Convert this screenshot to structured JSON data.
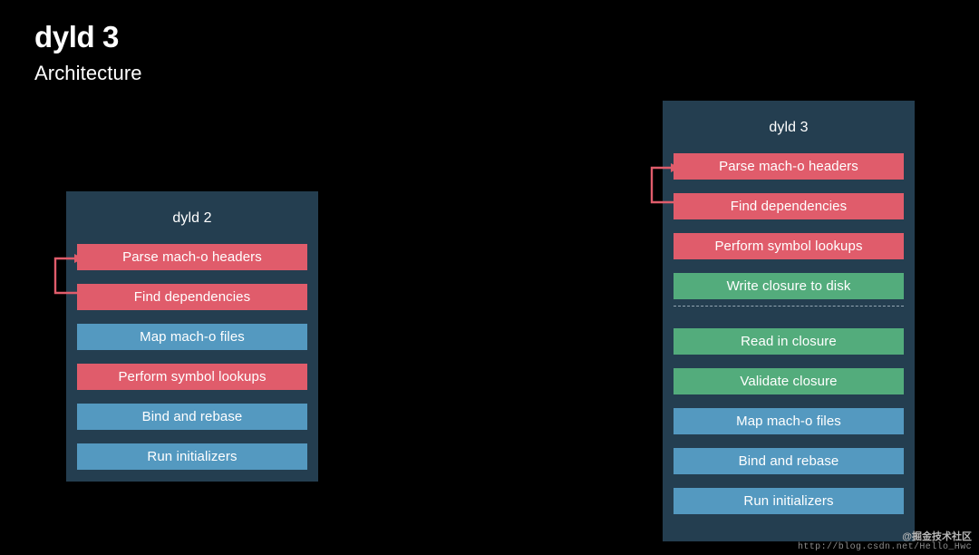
{
  "slide": {
    "title": "dyld 3",
    "subtitle": "Architecture",
    "background_color": "#000000"
  },
  "colors": {
    "panel": "#243e50",
    "red": "#e05c6b",
    "blue": "#5499c0",
    "green": "#53ac7c",
    "arrow": "#e05c6b",
    "divider": "#93a6b2",
    "text": "#ffffff"
  },
  "panels": [
    {
      "id": "dyld2",
      "title": "dyld 2",
      "steps": [
        {
          "label": "Parse mach-o headers",
          "color": "red"
        },
        {
          "label": "Find dependencies",
          "color": "red"
        },
        {
          "label": "Map mach-o files",
          "color": "blue"
        },
        {
          "label": "Perform symbol lookups",
          "color": "red"
        },
        {
          "label": "Bind and rebase",
          "color": "blue"
        },
        {
          "label": "Run initializers",
          "color": "blue"
        }
      ],
      "loop_arrow": {
        "from_step": "Find dependencies",
        "to_step": "Parse mach-o headers"
      }
    },
    {
      "id": "dyld3",
      "title": "dyld 3",
      "steps": [
        {
          "label": "Parse mach-o headers",
          "color": "red"
        },
        {
          "label": "Find dependencies",
          "color": "red"
        },
        {
          "label": "Perform symbol lookups",
          "color": "red"
        },
        {
          "label": "Write closure to disk",
          "color": "green"
        },
        {
          "label": "__divider__",
          "color": "divider"
        },
        {
          "label": "Read in closure",
          "color": "green"
        },
        {
          "label": "Validate closure",
          "color": "green"
        },
        {
          "label": "Map mach-o files",
          "color": "blue"
        },
        {
          "label": "Bind and rebase",
          "color": "blue"
        },
        {
          "label": "Run initializers",
          "color": "blue"
        }
      ],
      "loop_arrow": {
        "from_step": "Find dependencies",
        "to_step": "Parse mach-o headers"
      }
    }
  ],
  "watermark": {
    "handle": "@掘金技术社区",
    "url": "http://blog.csdn.net/Hello_Hwc"
  }
}
